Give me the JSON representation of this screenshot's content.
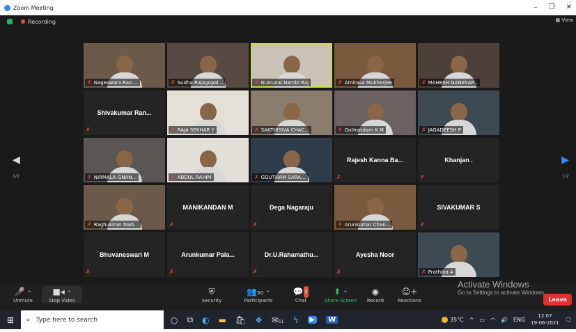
{
  "window": {
    "title": "Zoom Meeting",
    "minimize": "–",
    "maximize": "❐",
    "close": "✕"
  },
  "topbar": {
    "recording": "Recording",
    "view": "View"
  },
  "nav": {
    "page_left": "1/2",
    "page_right": "1/2"
  },
  "participants": [
    {
      "name": "Nageswara Rao ...",
      "video": true,
      "label": true
    },
    {
      "name": "Sudha Rajagopal...",
      "video": true,
      "label": true
    },
    {
      "name": "N.Arunai Nambi Raj",
      "video": true,
      "label": true,
      "speaking": true
    },
    {
      "name": "Amitava Mukherjee",
      "video": true,
      "label": true
    },
    {
      "name": "MAHESH GANESAP...",
      "video": true,
      "label": true
    },
    {
      "name": "Shivakumar  Ran...",
      "video": false
    },
    {
      "name": "RAJA SEKHAR Y",
      "video": true,
      "label": true
    },
    {
      "name": "SAKTHISIVA CHAC...",
      "video": true,
      "label": true
    },
    {
      "name": "Gothandam K M",
      "video": true,
      "label": true
    },
    {
      "name": "JAGADEESH P",
      "video": true,
      "label": true
    },
    {
      "name": "NIRMALA GNAN...",
      "video": true,
      "label": true
    },
    {
      "name": "ABDUL RAHIM",
      "video": true,
      "label": true
    },
    {
      "name": "GOUTHAM SARA...",
      "video": true,
      "label": true
    },
    {
      "name": "Rajesh  Kanna  Ba...",
      "video": false
    },
    {
      "name": "Khanjan .",
      "video": false
    },
    {
      "name": "Raghukiran Nadi...",
      "video": true,
      "label": true
    },
    {
      "name": "MANIKANDAN M",
      "video": false
    },
    {
      "name": "Dega Nagaraju",
      "video": false
    },
    {
      "name": "Arunkumar Chan...",
      "video": true,
      "label": true
    },
    {
      "name": "SIVAKUMAR S",
      "video": false
    },
    {
      "name": "Bhuvaneswari M",
      "video": false
    },
    {
      "name": "Arunkumar  Pala...",
      "video": false
    },
    {
      "name": "Dr.U.Rahamathu...",
      "video": false
    },
    {
      "name": "Ayesha Noor",
      "video": false
    },
    {
      "name": "Prathiba A",
      "video": true,
      "label": true
    }
  ],
  "toolbar": {
    "unmute": "Unmute",
    "stop_video": "Stop Video",
    "security": "Security",
    "participants": "Participants",
    "participants_count": "50",
    "chat": "Chat",
    "chat_badge": "3",
    "share_screen": "Share Screen",
    "record": "Record",
    "reactions": "Reactions",
    "leave": "Leave"
  },
  "watermark": {
    "line1": "Activate Windows",
    "line2": "Go to Settings to activate Windows."
  },
  "taskbar": {
    "search_placeholder": "Type here to search",
    "mail_badge": "11",
    "temperature": "35°C",
    "language": "ENG",
    "time": "12:07",
    "date": "19-06-2021"
  }
}
